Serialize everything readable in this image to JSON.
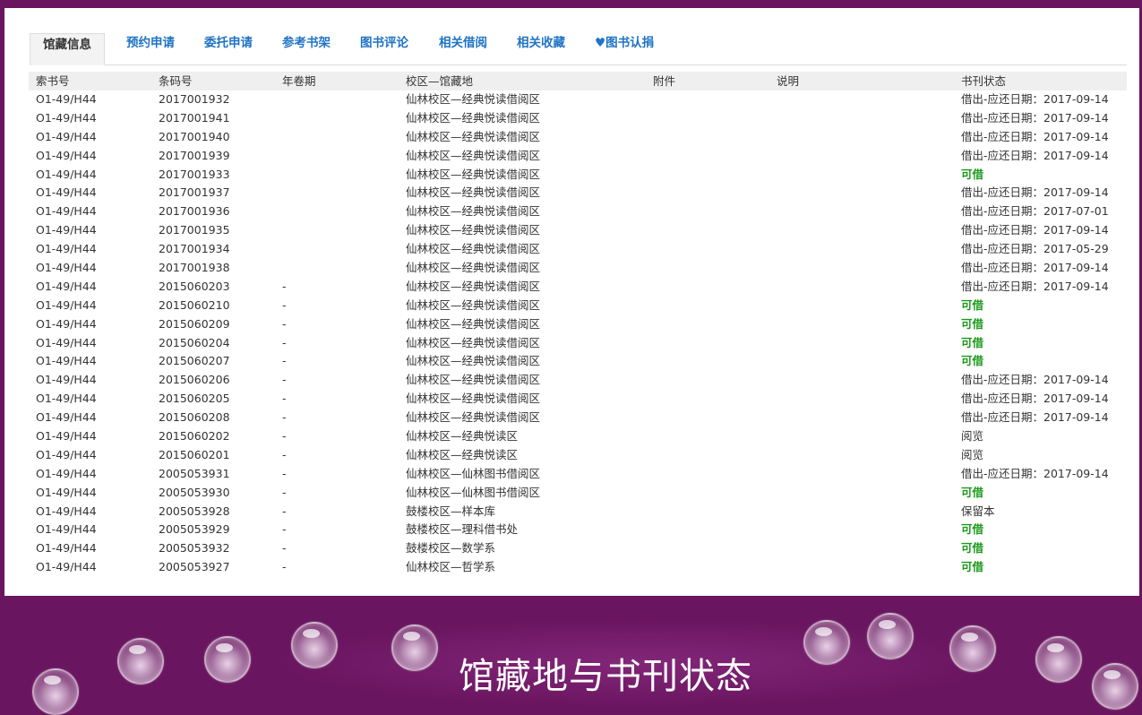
{
  "tabs": [
    {
      "label": "馆藏信息",
      "active": true
    },
    {
      "label": "预约申请"
    },
    {
      "label": "委托申请"
    },
    {
      "label": "参考书架"
    },
    {
      "label": "图书评论"
    },
    {
      "label": "相关借阅"
    },
    {
      "label": "相关收藏"
    },
    {
      "label": "♥图书认捐"
    }
  ],
  "table": {
    "headers": [
      "索书号",
      "条码号",
      "年卷期",
      "校区—馆藏地",
      "附件",
      "说明",
      "书刊状态"
    ],
    "rows": [
      {
        "call": "O1-49/H44",
        "barcode": "2017001932",
        "vol": "",
        "loc": "仙林校区—经典悦读借阅区",
        "att": "",
        "note": "",
        "status": "借出-应还日期：2017-09-14",
        "green": false
      },
      {
        "call": "O1-49/H44",
        "barcode": "2017001941",
        "vol": "",
        "loc": "仙林校区—经典悦读借阅区",
        "att": "",
        "note": "",
        "status": "借出-应还日期：2017-09-14",
        "green": false
      },
      {
        "call": "O1-49/H44",
        "barcode": "2017001940",
        "vol": "",
        "loc": "仙林校区—经典悦读借阅区",
        "att": "",
        "note": "",
        "status": "借出-应还日期：2017-09-14",
        "green": false
      },
      {
        "call": "O1-49/H44",
        "barcode": "2017001939",
        "vol": "",
        "loc": "仙林校区—经典悦读借阅区",
        "att": "",
        "note": "",
        "status": "借出-应还日期：2017-09-14",
        "green": false
      },
      {
        "call": "O1-49/H44",
        "barcode": "2017001933",
        "vol": "",
        "loc": "仙林校区—经典悦读借阅区",
        "att": "",
        "note": "",
        "status": "可借",
        "green": true
      },
      {
        "call": "O1-49/H44",
        "barcode": "2017001937",
        "vol": "",
        "loc": "仙林校区—经典悦读借阅区",
        "att": "",
        "note": "",
        "status": "借出-应还日期：2017-09-14",
        "green": false
      },
      {
        "call": "O1-49/H44",
        "barcode": "2017001936",
        "vol": "",
        "loc": "仙林校区—经典悦读借阅区",
        "att": "",
        "note": "",
        "status": "借出-应还日期：2017-07-01",
        "green": false
      },
      {
        "call": "O1-49/H44",
        "barcode": "2017001935",
        "vol": "",
        "loc": "仙林校区—经典悦读借阅区",
        "att": "",
        "note": "",
        "status": "借出-应还日期：2017-09-14",
        "green": false
      },
      {
        "call": "O1-49/H44",
        "barcode": "2017001934",
        "vol": "",
        "loc": "仙林校区—经典悦读借阅区",
        "att": "",
        "note": "",
        "status": "借出-应还日期：2017-05-29",
        "green": false
      },
      {
        "call": "O1-49/H44",
        "barcode": "2017001938",
        "vol": "",
        "loc": "仙林校区—经典悦读借阅区",
        "att": "",
        "note": "",
        "status": "借出-应还日期：2017-09-14",
        "green": false
      },
      {
        "call": "O1-49/H44",
        "barcode": "2015060203",
        "vol": "-",
        "loc": "仙林校区—经典悦读借阅区",
        "att": "",
        "note": "",
        "status": "借出-应还日期：2017-09-14",
        "green": false
      },
      {
        "call": "O1-49/H44",
        "barcode": "2015060210",
        "vol": "-",
        "loc": "仙林校区—经典悦读借阅区",
        "att": "",
        "note": "",
        "status": "可借",
        "green": true
      },
      {
        "call": "O1-49/H44",
        "barcode": "2015060209",
        "vol": "-",
        "loc": "仙林校区—经典悦读借阅区",
        "att": "",
        "note": "",
        "status": "可借",
        "green": true
      },
      {
        "call": "O1-49/H44",
        "barcode": "2015060204",
        "vol": "-",
        "loc": "仙林校区—经典悦读借阅区",
        "att": "",
        "note": "",
        "status": "可借",
        "green": true
      },
      {
        "call": "O1-49/H44",
        "barcode": "2015060207",
        "vol": "-",
        "loc": "仙林校区—经典悦读借阅区",
        "att": "",
        "note": "",
        "status": "可借",
        "green": true
      },
      {
        "call": "O1-49/H44",
        "barcode": "2015060206",
        "vol": "-",
        "loc": "仙林校区—经典悦读借阅区",
        "att": "",
        "note": "",
        "status": "借出-应还日期：2017-09-14",
        "green": false
      },
      {
        "call": "O1-49/H44",
        "barcode": "2015060205",
        "vol": "-",
        "loc": "仙林校区—经典悦读借阅区",
        "att": "",
        "note": "",
        "status": "借出-应还日期：2017-09-14",
        "green": false
      },
      {
        "call": "O1-49/H44",
        "barcode": "2015060208",
        "vol": "-",
        "loc": "仙林校区—经典悦读借阅区",
        "att": "",
        "note": "",
        "status": "借出-应还日期：2017-09-14",
        "green": false
      },
      {
        "call": "O1-49/H44",
        "barcode": "2015060202",
        "vol": "-",
        "loc": "仙林校区—经典悦读区",
        "att": "",
        "note": "",
        "status": "阅览",
        "green": false
      },
      {
        "call": "O1-49/H44",
        "barcode": "2015060201",
        "vol": "-",
        "loc": "仙林校区—经典悦读区",
        "att": "",
        "note": "",
        "status": "阅览",
        "green": false
      },
      {
        "call": "O1-49/H44",
        "barcode": "2005053931",
        "vol": "-",
        "loc": "仙林校区—仙林图书借阅区",
        "att": "",
        "note": "",
        "status": "借出-应还日期：2017-09-14",
        "green": false
      },
      {
        "call": "O1-49/H44",
        "barcode": "2005053930",
        "vol": "-",
        "loc": "仙林校区—仙林图书借阅区",
        "att": "",
        "note": "",
        "status": "可借",
        "green": true
      },
      {
        "call": "O1-49/H44",
        "barcode": "2005053928",
        "vol": "-",
        "loc": "鼓楼校区—样本库",
        "att": "",
        "note": "",
        "status": "保留本",
        "green": false
      },
      {
        "call": "O1-49/H44",
        "barcode": "2005053929",
        "vol": "-",
        "loc": "鼓楼校区—理科借书处",
        "att": "",
        "note": "",
        "status": "可借",
        "green": true
      },
      {
        "call": "O1-49/H44",
        "barcode": "2005053932",
        "vol": "-",
        "loc": "鼓楼校区—数学系",
        "att": "",
        "note": "",
        "status": "可借",
        "green": true
      },
      {
        "call": "O1-49/H44",
        "barcode": "2005053927",
        "vol": "-",
        "loc": "仙林校区—哲学系",
        "att": "",
        "note": "",
        "status": "可借",
        "green": true
      }
    ]
  },
  "footer": {
    "title": "馆藏地与书刊状态"
  },
  "colors": {
    "background": "#6a1560",
    "tab_text": "#1f73c4",
    "available": "#1a9a1a"
  }
}
